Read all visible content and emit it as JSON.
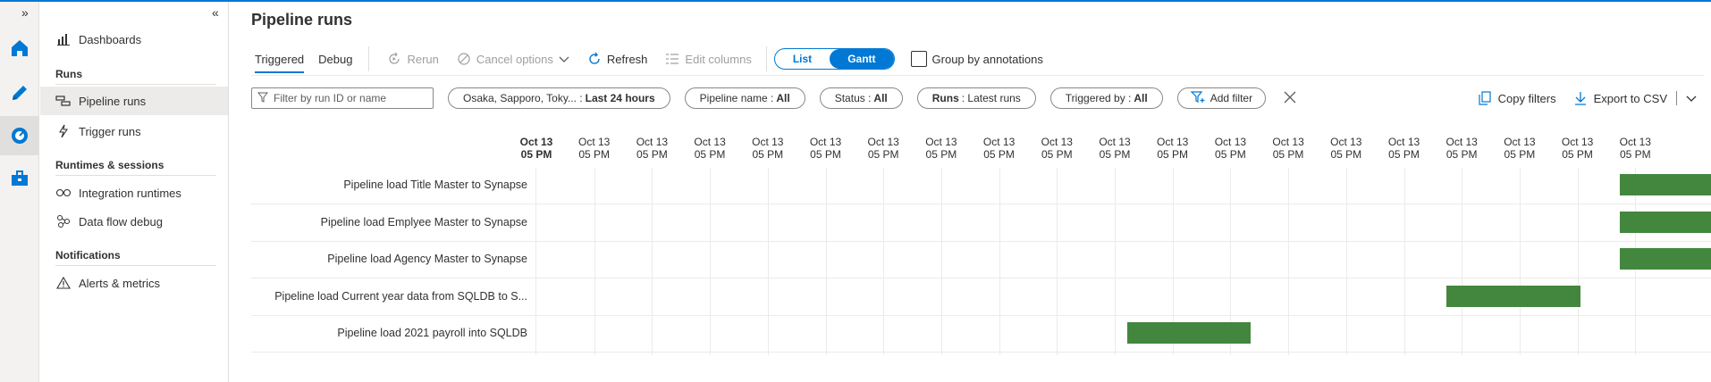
{
  "rail": {
    "expand_glyph": "»",
    "items": [
      {
        "name": "home-icon",
        "active": false
      },
      {
        "name": "pencil-icon",
        "active": false
      },
      {
        "name": "monitor-icon",
        "active": true
      },
      {
        "name": "toolbox-icon",
        "active": false
      }
    ]
  },
  "sidebar": {
    "collapse_glyph": "«",
    "dashboards": "Dashboards",
    "section_runs": "Runs",
    "pipeline_runs": "Pipeline runs",
    "trigger_runs": "Trigger runs",
    "section_runtimes": "Runtimes & sessions",
    "integration_runtimes": "Integration runtimes",
    "data_flow_debug": "Data flow debug",
    "section_notifications": "Notifications",
    "alerts_metrics": "Alerts & metrics"
  },
  "page": {
    "title": "Pipeline runs"
  },
  "toolbar": {
    "tab_triggered": "Triggered",
    "tab_debug": "Debug",
    "rerun": "Rerun",
    "cancel_options": "Cancel options",
    "refresh": "Refresh",
    "edit_columns": "Edit columns",
    "view_list": "List",
    "view_gantt": "Gantt",
    "group_by": "Group by annotations"
  },
  "filters": {
    "search_placeholder": "Filter by run ID or name",
    "timezone_label": "Osaka, Sapporo, Toky... :",
    "timezone_value": "Last 24 hours",
    "pipeline_label": "Pipeline name :",
    "pipeline_value": "All",
    "status_label": "Status :",
    "status_value": "All",
    "runs_label": "Runs",
    "runs_value": ": Latest runs",
    "triggered_label": "Triggered by :",
    "triggered_value": "All",
    "add_filter": "Add filter",
    "copy_filters": "Copy filters",
    "export_csv": "Export to CSV"
  },
  "gantt": {
    "ticks": [
      {
        "date": "Oct 13",
        "time": "05 PM"
      },
      {
        "date": "Oct 13",
        "time": "05 PM"
      },
      {
        "date": "Oct 13",
        "time": "05 PM"
      },
      {
        "date": "Oct 13",
        "time": "05 PM"
      },
      {
        "date": "Oct 13",
        "time": "05 PM"
      },
      {
        "date": "Oct 13",
        "time": "05 PM"
      },
      {
        "date": "Oct 13",
        "time": "05 PM"
      },
      {
        "date": "Oct 13",
        "time": "05 PM"
      },
      {
        "date": "Oct 13",
        "time": "05 PM"
      },
      {
        "date": "Oct 13",
        "time": "05 PM"
      },
      {
        "date": "Oct 13",
        "time": "05 PM"
      },
      {
        "date": "Oct 13",
        "time": "05 PM"
      },
      {
        "date": "Oct 13",
        "time": "05 PM"
      },
      {
        "date": "Oct 13",
        "time": "05 PM"
      },
      {
        "date": "Oct 13",
        "time": "05 PM"
      },
      {
        "date": "Oct 13",
        "time": "05 PM"
      },
      {
        "date": "Oct 13",
        "time": "05 PM"
      },
      {
        "date": "Oct 13",
        "time": "05 PM"
      },
      {
        "date": "Oct 13",
        "time": "05 PM"
      },
      {
        "date": "Oct 13",
        "time": "05 PM"
      }
    ],
    "bar_color": "#43873e",
    "rows": [
      {
        "label": "Pipeline load Title Master to Synapse",
        "start": 18.74,
        "end": 20.67
      },
      {
        "label": "Pipeline load Emplyee Master to Synapse",
        "start": 18.74,
        "end": 20.79
      },
      {
        "label": "Pipeline load Agency Master to Synapse",
        "start": 18.74,
        "end": 20.95
      },
      {
        "label": "Pipeline load Current year data from SQLDB to S...",
        "start": 15.74,
        "end": 18.05
      },
      {
        "label": "Pipeline load 2021 payroll into SQLDB",
        "start": 10.22,
        "end": 12.35
      }
    ]
  }
}
